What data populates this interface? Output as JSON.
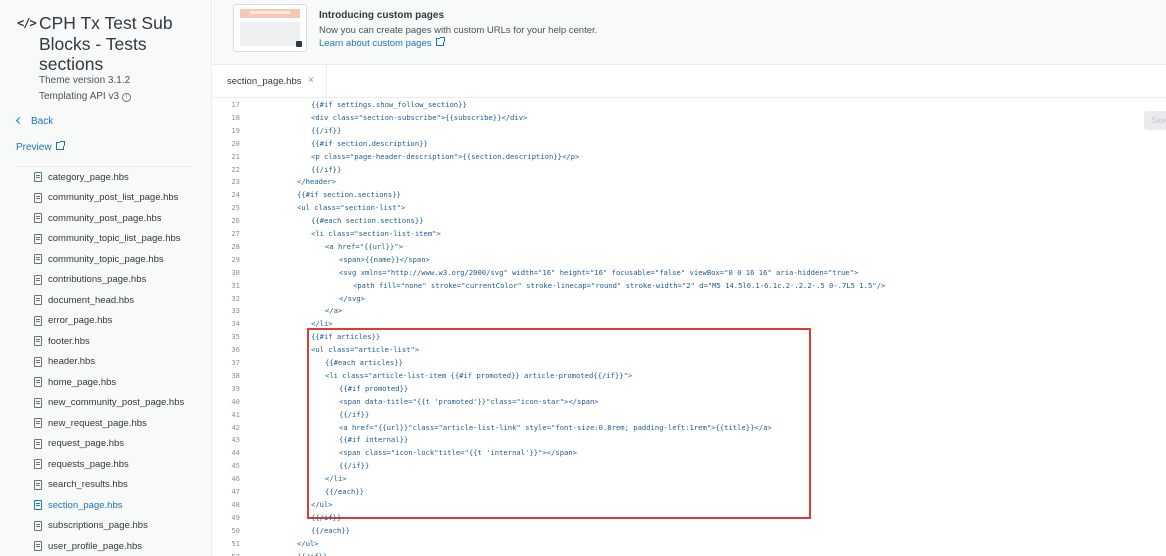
{
  "sidebar": {
    "theme_title": "CPH Tx Test Sub Blocks - Tests sections",
    "theme_version": "Theme version 3.1.2",
    "templating_api": "Templating API v3",
    "back_label": "Back",
    "preview_label": "Preview",
    "files": [
      "category_page.hbs",
      "community_post_list_page.hbs",
      "community_post_page.hbs",
      "community_topic_list_page.hbs",
      "community_topic_page.hbs",
      "contributions_page.hbs",
      "document_head.hbs",
      "error_page.hbs",
      "footer.hbs",
      "header.hbs",
      "home_page.hbs",
      "new_community_post_page.hbs",
      "new_request_page.hbs",
      "request_page.hbs",
      "requests_page.hbs",
      "search_results.hbs",
      "section_page.hbs",
      "subscriptions_page.hbs",
      "user_profile_page.hbs"
    ],
    "active_file": "section_page.hbs"
  },
  "banner": {
    "title": "Introducing custom pages",
    "text": "Now you can create pages with custom URLs for your help center.",
    "link": "Learn about custom pages"
  },
  "tab": {
    "label": "section_page.hbs",
    "close": "×"
  },
  "save_label": "Save",
  "colors": {
    "accent": "#1f73b7",
    "highlight_border": "#d93d35",
    "code_text": "#1d5b94"
  },
  "editor": {
    "lines": [
      {
        "n": "17",
        "code": "{{#if settings.show_follow_section}}"
      },
      {
        "n": "18",
        "code": "<div class=\"section-subscribe\">{{subscribe}}</div>"
      },
      {
        "n": "19",
        "code": "{{/if}}"
      },
      {
        "n": "20",
        "code": "{{#if section.description}}"
      },
      {
        "n": "21",
        "code": "<p class=\"page-header-description\">{{section.description}}</p>"
      },
      {
        "n": "22",
        "code": "{{/if}}"
      },
      {
        "n": "23",
        "code": "</header>"
      },
      {
        "n": "24",
        "code": "{{#if section.sections}}"
      },
      {
        "n": "25",
        "code": "<ul class=\"section-list\">"
      },
      {
        "n": "26",
        "code": "{{#each section.sections}}"
      },
      {
        "n": "27",
        "code": "<li class=\"section-list-item\">"
      },
      {
        "n": "28",
        "code": "<a href=\"{{url}}\">"
      },
      {
        "n": "29",
        "code": "<span>{{name}}</span>"
      },
      {
        "n": "30",
        "code": "<svg xmlns=\"http://www.w3.org/2000/svg\" width=\"16\" height=\"16\" focusable=\"false\" viewBox=\"0 0 16 16\" aria-hidden=\"true\">"
      },
      {
        "n": "31",
        "code": "<path fill=\"none\" stroke=\"currentColor\" stroke-linecap=\"round\" stroke-width=\"2\" d=\"M5 14.5l6.1-6.1c.2-.2.2-.5 0-.7L5 1.5\"/>"
      },
      {
        "n": "32",
        "code": "</svg>"
      },
      {
        "n": "33",
        "code": "</a>"
      },
      {
        "n": "34",
        "code": "</li>"
      },
      {
        "n": "35",
        "code": "{{#if articles}}"
      },
      {
        "n": "36",
        "code": "<ul class=\"article-list\">"
      },
      {
        "n": "37",
        "code": "{{#each articles}}"
      },
      {
        "n": "38",
        "code": "<li class=\"article-list-item {{#if promoted}} article-promoted{{/if}}\">"
      },
      {
        "n": "39",
        "code": "{{#if promoted}}"
      },
      {
        "n": "40",
        "code": "<span data-title=\"{{t 'promoted'}}\"class=\"icon-star\"></span>"
      },
      {
        "n": "41",
        "code": "{{/if}}"
      },
      {
        "n": "42",
        "code": "<a href=\"{{url}}\"class=\"article-list-link\" style=\"font-size:0.8rem; padding-left:1rem\">{{title}}</a>"
      },
      {
        "n": "43",
        "code": "{{#if internal}}"
      },
      {
        "n": "44",
        "code": "<span class=\"icon-lock\"title=\"{{t 'internal'}}\"></span>"
      },
      {
        "n": "45",
        "code": "{{/if}}"
      },
      {
        "n": "46",
        "code": "</li>"
      },
      {
        "n": "47",
        "code": "{{/each}}"
      },
      {
        "n": "48",
        "code": "</ul>"
      },
      {
        "n": "49",
        "code": "{{/if}}"
      },
      {
        "n": "50",
        "code": "{{/each}}"
      },
      {
        "n": "51",
        "code": "</ul>"
      },
      {
        "n": "52",
        "code": "{{/if}}"
      }
    ]
  }
}
